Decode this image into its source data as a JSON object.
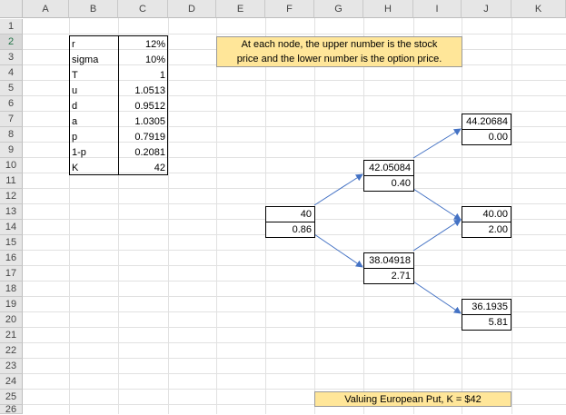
{
  "columns": [
    "A",
    "B",
    "C",
    "D",
    "E",
    "F",
    "G",
    "H",
    "I",
    "J",
    "K"
  ],
  "rows": [
    "1",
    "2",
    "3",
    "4",
    "5",
    "6",
    "7",
    "8",
    "9",
    "10",
    "11",
    "12",
    "13",
    "14",
    "15",
    "16",
    "17",
    "18",
    "19",
    "20",
    "21",
    "22",
    "23",
    "24",
    "25",
    "26"
  ],
  "parameters": [
    {
      "label": "r",
      "value": "12%"
    },
    {
      "label": "sigma",
      "value": "10%"
    },
    {
      "label": "T",
      "value": "1"
    },
    {
      "label": "u",
      "value": "1.0513"
    },
    {
      "label": "d",
      "value": "0.9512"
    },
    {
      "label": "a",
      "value": "1.0305"
    },
    {
      "label": "p",
      "value": "0.7919"
    },
    {
      "label": "1-p",
      "value": "0.2081"
    },
    {
      "label": "K",
      "value": "42"
    }
  ],
  "note": {
    "line1": "At each node, the upper number is the stock",
    "line2": "price and the lower number is the option price."
  },
  "nodes": {
    "root": {
      "stock": "40",
      "option": "0.86"
    },
    "up": {
      "stock": "42.05084",
      "option": "0.40"
    },
    "down": {
      "stock": "38.04918",
      "option": "2.71"
    },
    "upup": {
      "stock": "44.20684",
      "option": "0.00"
    },
    "updown": {
      "stock": "40.00",
      "option": "2.00"
    },
    "downdown": {
      "stock": "36.1935",
      "option": "5.81"
    }
  },
  "title": "Valuing European Put, K = $42",
  "colors": {
    "note_fill": "#ffe699",
    "arrow": "#4472c4",
    "grid": "#e1e1e1"
  }
}
